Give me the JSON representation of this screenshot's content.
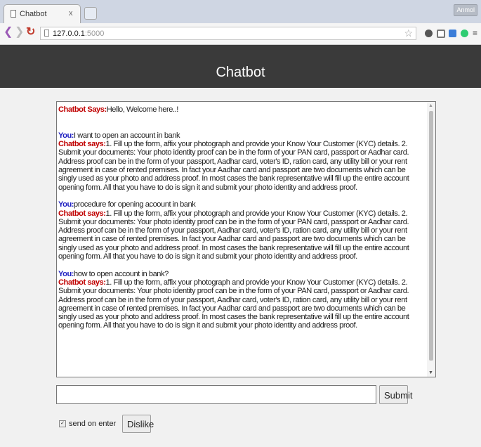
{
  "browser": {
    "tab_title": "Chatbot",
    "tab_close": "x",
    "url_host": "127.0.0.1",
    "url_port": ":5000",
    "user_badge": "Anmol",
    "icons": [
      "back-icon",
      "forward-icon",
      "reload-icon",
      "page-icon",
      "star-icon",
      "extension-icon",
      "camera-icon",
      "bookmark-icon",
      "refresh-extension-icon",
      "menu-icon"
    ]
  },
  "page": {
    "title": "Chatbot"
  },
  "chat": {
    "greeting": {
      "label": "Chatbot Says:",
      "text": "Hello, Welcome here..!"
    },
    "exchanges": [
      {
        "you_label": "You:",
        "you_text": "I want to open an account in bank",
        "bot_label": "Chatbot says:",
        "bot_text": "1. Fill up the form, affix your photograph and provide your Know Your Customer (KYC) details. 2. Submit your documents: Your photo identity proof can be in the form of your PAN card, passport or Aadhar card. Address proof can be in the form of your passport, Aadhar card, voter's ID, ration card, any utility bill or your rent agreement in case of rented premises. In fact your Aadhar card and passport are two documents which can be singly used as your photo and address proof. In most cases the bank representative will fill up the entire account opening form. All that you have to do is sign it and submit your photo identity and address proof."
      },
      {
        "you_label": "You:",
        "you_text": "procedure for opening acoount in bank",
        "bot_label": "Chatbot says:",
        "bot_text": "1. Fill up the form, affix your photograph and provide your Know Your Customer (KYC) details. 2. Submit your documents: Your photo identity proof can be in the form of your PAN card, passport or Aadhar card. Address proof can be in the form of your passport, Aadhar card, voter's ID, ration card, any utility bill or your rent agreement in case of rented premises. In fact your Aadhar card and passport are two documents which can be singly used as your photo and address proof. In most cases the bank representative will fill up the entire account opening form. All that you have to do is sign it and submit your photo identity and address proof."
      },
      {
        "you_label": "You:",
        "you_text": "how to open account in bank?",
        "bot_label": "Chatbot says:",
        "bot_text": "1. Fill up the form, affix your photograph and provide your Know Your Customer (KYC) details. 2. Submit your documents: Your photo identity proof can be in the form of your PAN card, passport or Aadhar card. Address proof can be in the form of your passport, Aadhar card, voter's ID, ration card, any utility bill or your rent agreement in case of rented premises. In fact your Aadhar card and passport are two documents which can be singly used as your photo and address proof. In most cases the bank representative will fill up the entire account opening form. All that you have to do is sign it and submit your photo identity and address proof."
      }
    ]
  },
  "composer": {
    "input_value": "",
    "submit_label": "Submit",
    "send_on_enter_label": "send on enter",
    "send_on_enter_checked": true,
    "dislike_label": "Dislike"
  },
  "colors": {
    "header_bg": "#3a3a3a",
    "bot_label": "#c00000",
    "you_label": "#1d1ec0"
  }
}
